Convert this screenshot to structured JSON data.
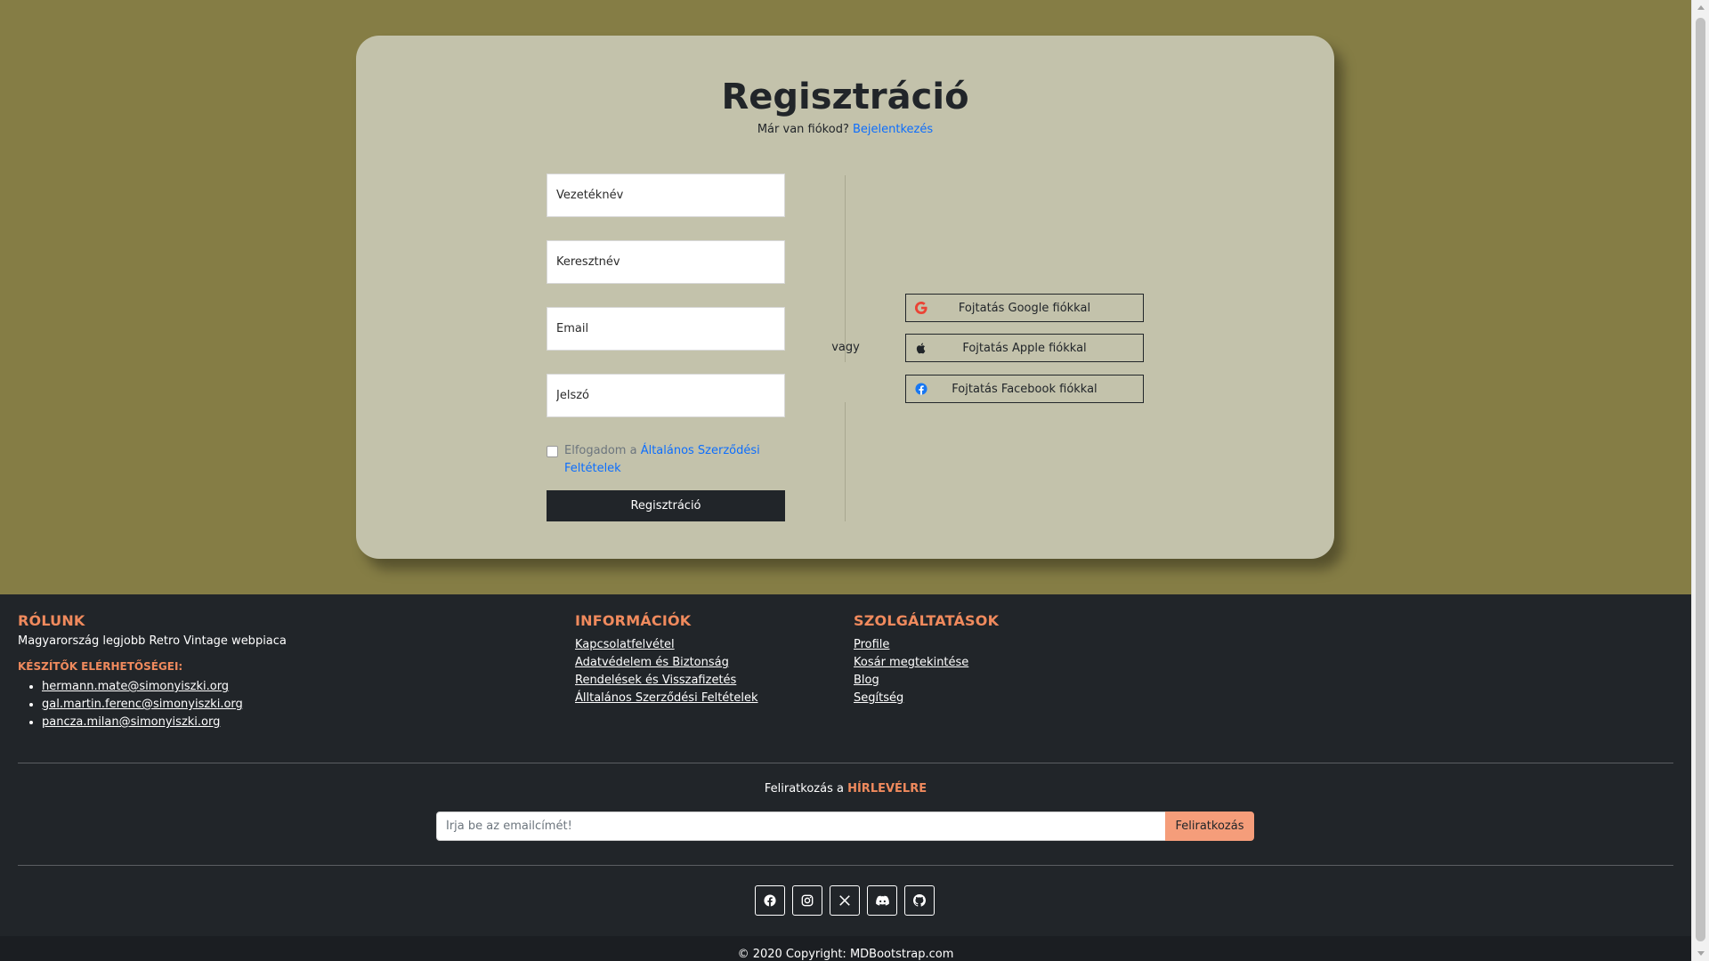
{
  "register": {
    "title": "Regisztráció",
    "have_account": "Már van fiókod?",
    "login_link": "Bejelentkezés",
    "fields": {
      "lastname_placeholder": "Vezetéknév",
      "firstname_placeholder": "Keresztnév",
      "email_placeholder": "Email",
      "password_placeholder": "Jelszó"
    },
    "terms_prefix": "Elfogadom a",
    "terms_link": "Általános Szerződési Feltételek",
    "terms_checked": false,
    "submit_label": "Regisztráció",
    "or_label": "vagy",
    "social": {
      "google": "Fojtatás Google fiókkal",
      "apple": "Fojtatás Apple fiókkal",
      "facebook": "Fojtatás Facebook fiókkal"
    },
    "google_icon": "google-icon",
    "apple_icon": "apple-icon",
    "facebook_icon": "facebook-icon"
  },
  "footer": {
    "about": {
      "title": "RÓLUNK",
      "text": "Magyarország legjobb Retro Vintage webpiaca",
      "contacts_title": "KÉSZÍTŐK ELÉRHETŐSÉGEI:",
      "emails": [
        "hermann.mate@simonyiszki.org",
        "gal.martin.ferenc@simonyiszki.org",
        "pancza.milan@simonyiszki.org"
      ]
    },
    "info": {
      "title": "INFORMÁCIÓK",
      "links": [
        "Kapcsolatfelvétel",
        "Adatvédelem és Biztonság",
        "Rendelések és Visszafizetés",
        "Álltalános Szerződési Feltételek"
      ]
    },
    "services": {
      "title": "SZOLGÁLTATÁSOK",
      "links": [
        "Profile",
        "Kosár megtekintése",
        "Blog",
        "Segítség"
      ]
    },
    "newsletter": {
      "prefix": "Feliratkozás a",
      "highlight": "HÍRLEVÉLRE",
      "placeholder": "Írja be az emailcímét!",
      "button": "Feliratkozás"
    },
    "social_icons": [
      "facebook-icon",
      "instagram-icon",
      "x-icon",
      "discord-icon",
      "github-icon"
    ],
    "copyright": "© 2020 Copyright: MDBootstrap.com"
  },
  "colors": {
    "background": "#857d45",
    "card": "#c3c2ab",
    "footer": "#212529",
    "accent": "#f08a5d",
    "link": "#0d6efd"
  }
}
